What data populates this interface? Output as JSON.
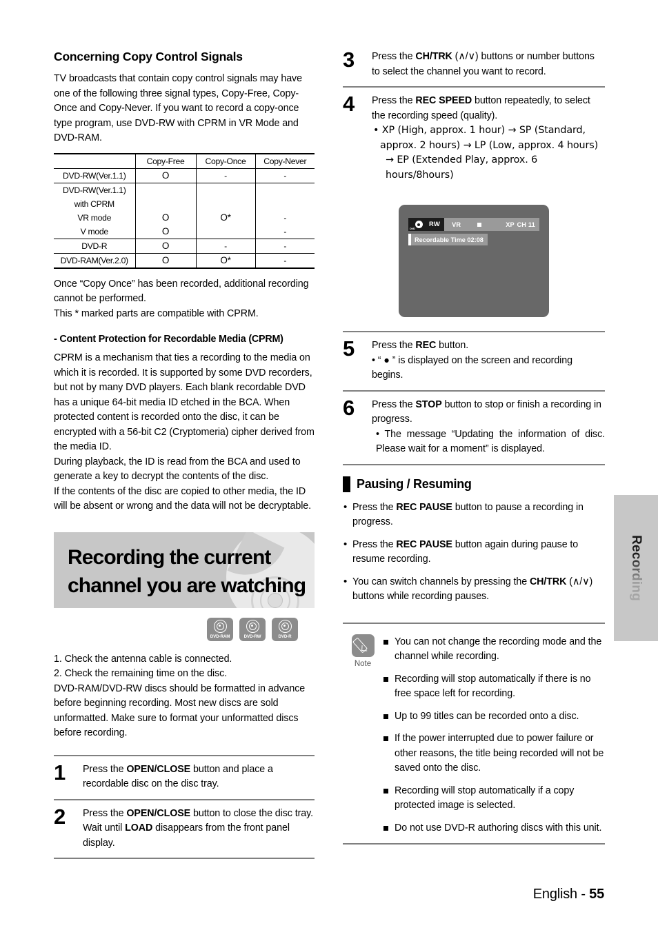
{
  "left": {
    "section_title": "Concerning Copy Control Signals",
    "intro": "TV broadcasts that contain copy control signals may have one of the following three signal types, Copy-Free, Copy-Once and Copy-Never. If you want to record a copy-once type program, use DVD-RW with CPRM in VR Mode and DVD-RAM.",
    "table": {
      "headers": [
        "",
        "Copy-Free",
        "Copy-Once",
        "Copy-Never"
      ],
      "rows": [
        {
          "label": "DVD-RW(Ver.1.1)",
          "cells": [
            "O",
            "-",
            "-"
          ]
        },
        {
          "label": "DVD-RW(Ver.1.1)",
          "cells": [
            "",
            "",
            ""
          ]
        },
        {
          "label": "with CPRM",
          "cells": [
            "",
            "",
            ""
          ]
        },
        {
          "label": "VR mode",
          "cells": [
            "O",
            "O*",
            "-"
          ]
        },
        {
          "label": "V mode",
          "cells": [
            "O",
            "",
            "-"
          ]
        },
        {
          "label": "DVD-R",
          "cells": [
            "O",
            "-",
            "-"
          ]
        },
        {
          "label": "DVD-RAM(Ver.2.0)",
          "cells": [
            "O",
            "O*",
            "-"
          ]
        }
      ]
    },
    "after_table_1": "Once “Copy Once” has been recorded, additional recording cannot be performed.",
    "after_table_2": "This * marked parts are compatible with CPRM.",
    "cprm_heading": "- Content Protection for Recordable Media (CPRM)",
    "cprm_p1": "CPRM is a mechanism that ties a recording to the media on which it is recorded. It is supported by some DVD recorders, but not by many DVD players. Each blank recordable DVD has a unique 64-bit media ID etched in the BCA. When protected content is recorded onto the disc, it can be encrypted with a 56-bit C2 (Cryptomeria) cipher derived from the media ID.",
    "cprm_p2": "During playback, the ID is read from the BCA and used to generate a key to decrypt the contents of the disc.",
    "cprm_p3": "If the contents of the disc are copied to other media, the ID will be absent or wrong and the data will not be decryptable.",
    "banner_title_line1": "Recording the current",
    "banner_title_line2": "channel you are watching",
    "badges": [
      "DVD-RAM",
      "DVD-RW",
      "DVD-R"
    ],
    "prep_1": "1. Check the antenna cable is connected.",
    "prep_2": "2. Check the remaining time on the disc.",
    "prep_3": "DVD-RAM/DVD-RW discs should be formatted in advance before beginning recording. Most new discs are sold unformatted. Make sure to format your unformatted discs before recording.",
    "steps": [
      {
        "num": "1",
        "text_parts": [
          "Press the ",
          "OPEN/CLOSE",
          " button and place a recordable disc on the disc tray."
        ]
      },
      {
        "num": "2",
        "text_parts": [
          "Press the ",
          "OPEN/CLOSE",
          " button to close the disc tray."
        ],
        "extra": [
          "Wait until ",
          "LOAD",
          " disappears from the front panel display."
        ]
      }
    ]
  },
  "right": {
    "step3": {
      "num": "3",
      "lead": "Press the ",
      "bold": "CH/TRK",
      "tail": " (∧/∨) buttons or number buttons to select the channel you want to record."
    },
    "step4": {
      "num": "4",
      "lead": "Press the ",
      "bold": "REC SPEED",
      "tail": " button repeatedly, to select the recording speed (quality).",
      "bullet_line1": "• XP (High, approx. 1 hour) → SP (Standard,",
      "bullet_line2": "approx. 2 hours) → LP (Low, approx. 4 hours)",
      "bullet_line3": "→ EP (Extended Play, approx. 6 hours/8hours)"
    },
    "osd": {
      "disc_icon_label": "DVD",
      "format": "RW",
      "mode": "VR",
      "status_icon": "stop-square",
      "speed": "XP",
      "channel": "CH 11",
      "recordable_time": "Recordable Time 02:08"
    },
    "step5": {
      "num": "5",
      "lead": "Press the ",
      "bold": "REC",
      "tail": " button.",
      "bullet": "• “ ● ” is displayed on the screen and recording begins."
    },
    "step6": {
      "num": "6",
      "lead": "Press the ",
      "bold": "STOP",
      "tail": " button to stop or finish a recording in progress.",
      "bullet": "• The message “Updating the information of disc. Please wait for a moment” is displayed."
    },
    "pausing": {
      "title": "Pausing / Resuming",
      "items": [
        {
          "lead": "Press the ",
          "bold": "REC PAUSE",
          "tail": " button to pause a recording in progress."
        },
        {
          "lead": "Press the ",
          "bold": "REC PAUSE",
          "tail": " button again during pause to resume recording."
        },
        {
          "lead": "You can switch channels by pressing the ",
          "bold": "CH/TRK",
          "tail": " (∧/∨) buttons while recording pauses."
        }
      ]
    },
    "note": {
      "label": "Note",
      "items": [
        "You can not change the recording mode and the channel while recording.",
        "Recording will stop automatically if there is no free space left for recording.",
        "Up to 99 titles can be recorded onto a disc.",
        "If the power interrupted due to power failure or other reasons, the title being recorded will not be saved onto the disc.",
        "Recording will stop automatically if a copy protected image is selected.",
        "Do not use DVD-R authoring discs with this unit."
      ]
    }
  },
  "side_tab": {
    "label": "Recording"
  },
  "footer": {
    "language": "English - ",
    "page": "55"
  },
  "colors": {
    "banner_bg": "#c7c7c7",
    "badge_gray": "#8c8c8c",
    "osd_bg": "#686868",
    "osd_bar": "#9a9a9a",
    "rule_gray": "#808080"
  }
}
